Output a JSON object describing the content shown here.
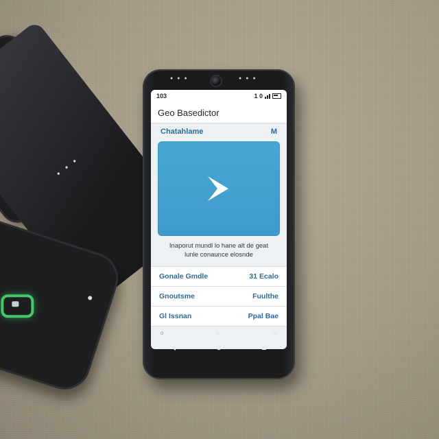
{
  "app": {
    "title": "Geo Basedictor"
  },
  "status_bar": {
    "left_text": "103",
    "right_text": "1 0"
  },
  "section": {
    "label": "Chatahlame",
    "meta": "M"
  },
  "hero": {
    "icon": "chevron-right-icon",
    "accent_color": "#47a6d3"
  },
  "caption": {
    "line1": "Inaporut mundl lo hane alt de geat",
    "line2": "lunle conaunce elosnde"
  },
  "list": {
    "items": [
      {
        "label": "Gonale Gmdle",
        "value": "31 Ecalo"
      },
      {
        "label": "Gnoutsme",
        "value": "Fuulthe"
      },
      {
        "label": "Gl Issnan",
        "value": "Ppal Bae"
      }
    ]
  },
  "nav_strip": {
    "left": "o",
    "right": "m"
  },
  "nav": {
    "back_icon": "back-triangle-icon",
    "home_icon": "home-circle-icon",
    "recents_icon": "recents-square-icon"
  }
}
